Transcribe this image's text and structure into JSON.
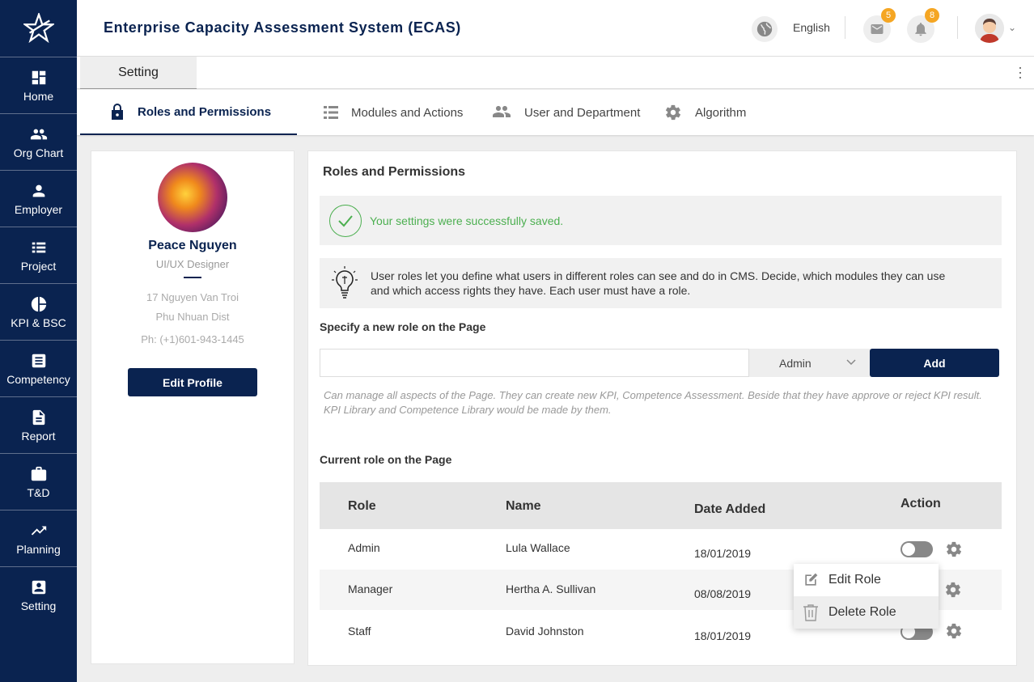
{
  "app": {
    "title": "Enterprise Capacity Assessment System (ECAS)"
  },
  "sidebar": {
    "items": [
      {
        "label": "Home",
        "icon": "dashboard-icon"
      },
      {
        "label": "Org Chart",
        "icon": "people-icon"
      },
      {
        "label": "Employer",
        "icon": "person-icon"
      },
      {
        "label": "Project",
        "icon": "list-icon"
      },
      {
        "label": "KPI & BSC",
        "icon": "pie-chart-icon"
      },
      {
        "label": "Competency",
        "icon": "document-icon"
      },
      {
        "label": "Report",
        "icon": "file-icon"
      },
      {
        "label": "T&D",
        "icon": "briefcase-icon"
      },
      {
        "label": "Planning",
        "icon": "trend-icon"
      },
      {
        "label": "Setting",
        "icon": "badge-icon"
      }
    ]
  },
  "header": {
    "language": "English",
    "mail_count": "5",
    "notification_count": "8"
  },
  "strip": {
    "tab": "Setting"
  },
  "subtabs": [
    {
      "label": "Roles and Permissions",
      "icon": "lock-icon"
    },
    {
      "label": "Modules and Actions",
      "icon": "list-icon"
    },
    {
      "label": "User and Department",
      "icon": "people-icon"
    },
    {
      "label": "Algorithm",
      "icon": "gear-icon"
    }
  ],
  "profile": {
    "name": "Peace Nguyen",
    "role": "UI/UX Designer",
    "address_line1": "17 Nguyen Van Troi",
    "address_line2": "Phu Nhuan Dist",
    "phone": "Ph: (+1)601-943-1445",
    "edit_label": "Edit Profile"
  },
  "panel": {
    "title": "Roles and Permissions",
    "success": "Your settings were successfully saved.",
    "info": "User roles let you define what users in different roles can see and do in CMS. Decide, which modules they can use and which access rights they have. Each user must have a role.",
    "specify_label": "Specify a new role on the Page",
    "input_value": "",
    "select_value": "Admin",
    "add_label": "Add",
    "hint": "Can manage all aspects of the Page. They can create new KPI, Competence Assessment. Beside that they have approve or reject KPI result. KPI Library and Competence Library would be made by them.",
    "current_label": "Current role on the Page"
  },
  "table": {
    "headers": {
      "role": "Role",
      "name": "Name",
      "date": "Date Added",
      "action": "Action"
    },
    "rows": [
      {
        "role": "Admin",
        "name": "Lula Wallace",
        "date": "18/01/2019"
      },
      {
        "role": "Manager",
        "name": "Hertha A. Sullivan",
        "date": "08/08/2019"
      },
      {
        "role": "Staff",
        "name": "David Johnston",
        "date": "18/01/2019"
      }
    ]
  },
  "context_menu": {
    "edit": "Edit Role",
    "delete": "Delete Role"
  },
  "colors": {
    "primary": "#0a2350",
    "success": "#4caf50",
    "badge": "#f5a623"
  }
}
